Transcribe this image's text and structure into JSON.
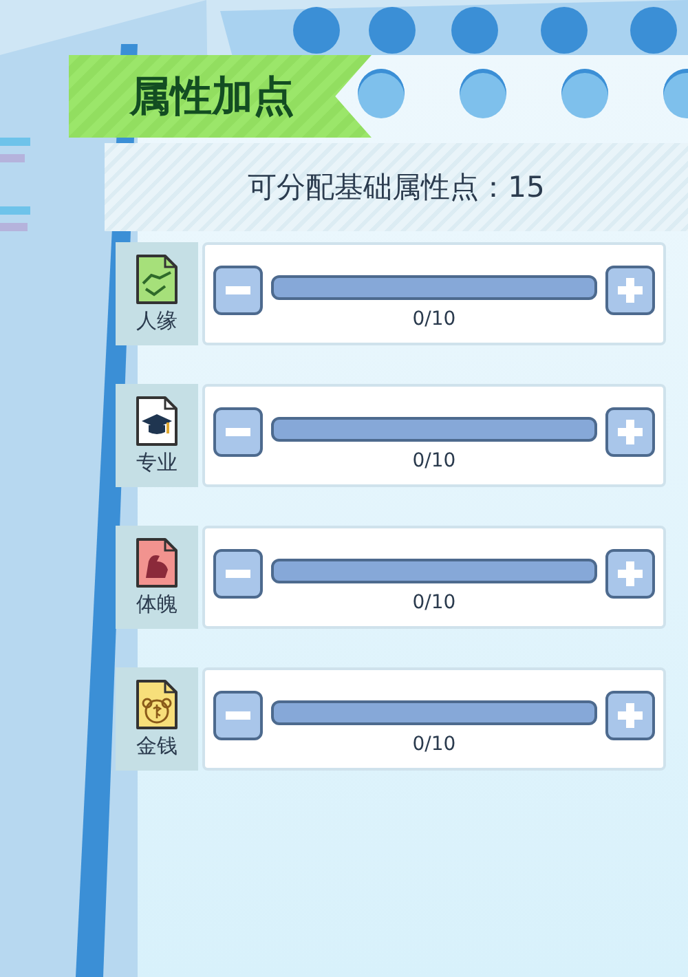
{
  "title": "属性加点",
  "points": {
    "label": "可分配基础属性点：15"
  },
  "attributes": [
    {
      "name": "人缘",
      "kind": "handshake",
      "color": "#a6e07a",
      "level": 0,
      "reading": "0/10"
    },
    {
      "name": "专业",
      "kind": "cap",
      "color": "#ffffff",
      "level": 0,
      "reading": "0/10"
    },
    {
      "name": "体魄",
      "kind": "muscle",
      "color": "#f2938f",
      "level": 0,
      "reading": "0/10"
    },
    {
      "name": "金钱",
      "kind": "money",
      "color": "#f7df7a",
      "level": 0,
      "reading": "0/10"
    }
  ]
}
